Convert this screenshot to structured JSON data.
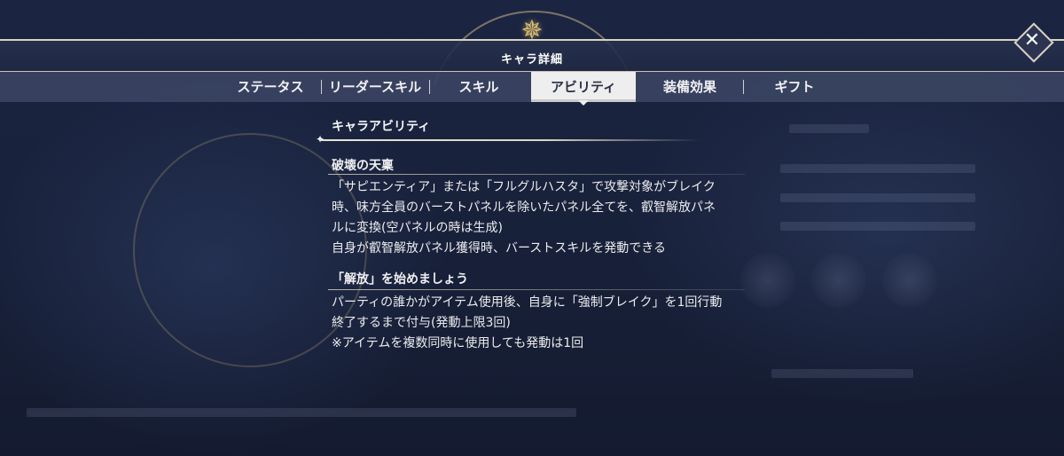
{
  "header": {
    "title": "キャラ詳細",
    "close_label": "✕"
  },
  "tabs": [
    {
      "label": "ステータス",
      "active": false
    },
    {
      "label": "リーダースキル",
      "active": false
    },
    {
      "label": "スキル",
      "active": false
    },
    {
      "label": "アビリティ",
      "active": true
    },
    {
      "label": "装備効果",
      "active": false
    },
    {
      "label": "ギフト",
      "active": false
    }
  ],
  "section": {
    "title": "キャラアビリティ"
  },
  "abilities": [
    {
      "name": "破壊の天稟",
      "lines": [
        "「サピエンティア」または「フルグルハスタ」で攻撃対象がブレイク",
        "時、味方全員のバーストパネルを除いたパネル全てを、叡智解放パネ",
        "ルに変換(空パネルの時は生成)",
        "自身が叡智解放パネル獲得時、バーストスキルを発動できる"
      ]
    },
    {
      "name": "「解放」を始めましょう",
      "lines": [
        "パーティの誰かがアイテム使用後、自身に「強制ブレイク」を1回行動",
        "終了するまで付与(発動上限3回)",
        "※アイテムを複数同時に使用しても発動は1回"
      ]
    }
  ],
  "icons": {
    "emblem": "compass-star-icon",
    "close": "close-icon"
  },
  "colors": {
    "background": "#16203a",
    "tab_bar": "#3a4462",
    "active_tab": "#eeeeee",
    "accent_gold": "#d9b96a"
  }
}
